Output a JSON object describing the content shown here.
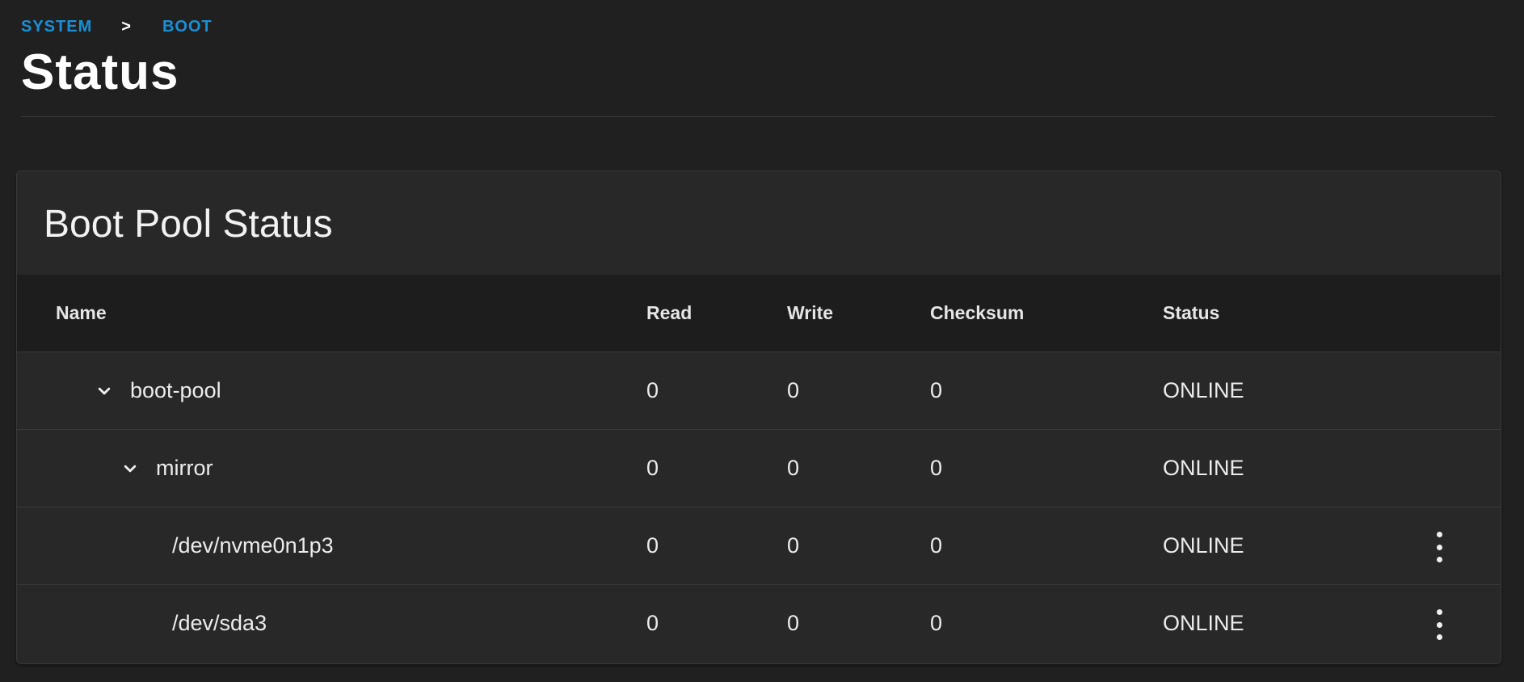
{
  "breadcrumb": {
    "items": [
      "SYSTEM",
      "BOOT"
    ],
    "separator": ">"
  },
  "page": {
    "title": "Status"
  },
  "card": {
    "title": "Boot Pool Status"
  },
  "table": {
    "columns": [
      "Name",
      "Read",
      "Write",
      "Checksum",
      "Status"
    ],
    "rows": [
      {
        "name": "boot-pool",
        "read": "0",
        "write": "0",
        "checksum": "0",
        "status": "ONLINE",
        "expandable": true,
        "level": 0
      },
      {
        "name": "mirror",
        "read": "0",
        "write": "0",
        "checksum": "0",
        "status": "ONLINE",
        "expandable": true,
        "level": 1
      },
      {
        "name": "/dev/nvme0n1p3",
        "read": "0",
        "write": "0",
        "checksum": "0",
        "status": "ONLINE",
        "expandable": false,
        "level": 2,
        "has_menu": true
      },
      {
        "name": "/dev/sda3",
        "read": "0",
        "write": "0",
        "checksum": "0",
        "status": "ONLINE",
        "expandable": false,
        "level": 2,
        "has_menu": true
      }
    ]
  },
  "icons": {
    "expand": "chevron-down-icon",
    "menu": "more-vert-icon"
  },
  "colors": {
    "background": "#202020",
    "card": "#282828",
    "header": "#1d1d1d",
    "accent": "#1a8fd6"
  }
}
